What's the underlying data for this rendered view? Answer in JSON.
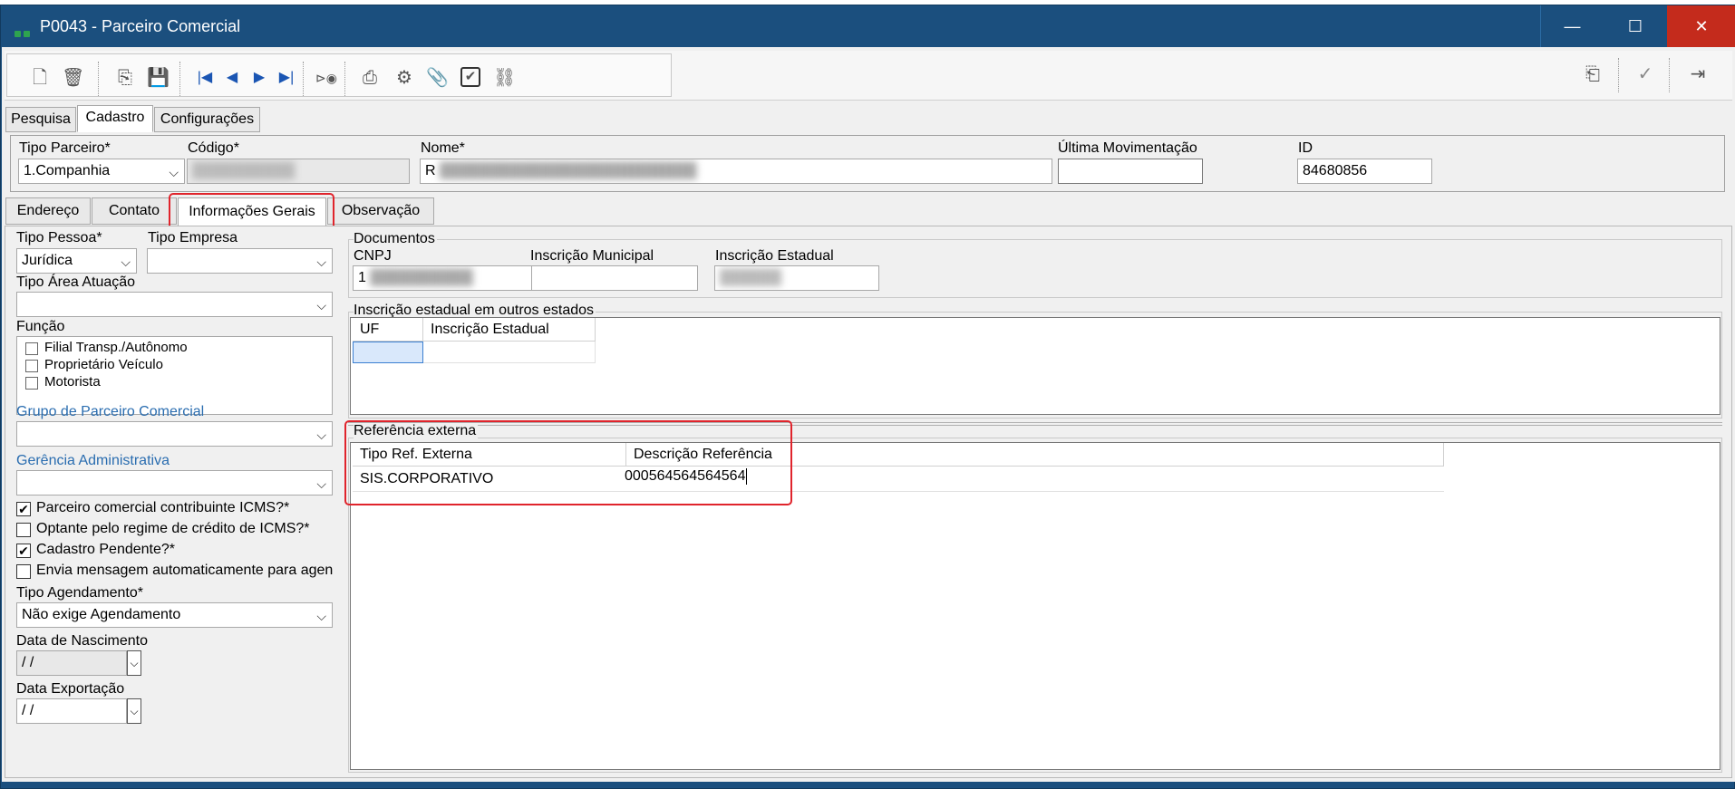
{
  "window": {
    "title": "P0043 - Parceiro Comercial",
    "controls": {
      "minimize": "—",
      "maximize": "☐",
      "close": "✕"
    }
  },
  "toolbar": {
    "left_icons": [
      "new-document-icon",
      "delete-icon",
      "copy-icon",
      "save-icon",
      "first-record-icon",
      "prev-record-icon",
      "next-record-icon",
      "last-record-icon",
      "search-record-icon",
      "print-icon",
      "settings-icon",
      "attach-icon",
      "checkbox-icon",
      "link-icon"
    ],
    "right_icons": [
      "import-icon",
      "confirm-check-icon",
      "exit-icon"
    ]
  },
  "main_tabs": [
    "Pesquisa",
    "Cadastro",
    "Configurações"
  ],
  "header": {
    "tipo_parceiro_label": "Tipo Parceiro*",
    "tipo_parceiro_value": "1.Companhia",
    "codigo_label": "Código*",
    "codigo_value": "",
    "nome_label": "Nome*",
    "nome_value": "R",
    "ultima_mov_label": "Última Movimentação",
    "ultima_mov_value": "",
    "id_label": "ID",
    "id_value": "84680856"
  },
  "sub_tabs": [
    "Endereço",
    "Contato",
    "Informações Gerais",
    "Observação"
  ],
  "left": {
    "tipo_pessoa_label": "Tipo Pessoa*",
    "tipo_pessoa_value": "Jurídica",
    "tipo_empresa_label": "Tipo Empresa",
    "tipo_empresa_value": "",
    "tipo_area_label": "Tipo Área Atuação",
    "tipo_area_value": "",
    "funcao_label": "Função",
    "funcao_items": [
      "Filial Transp./Autônomo",
      "Proprietário Veículo",
      "Motorista"
    ],
    "grupo_label": "Grupo de Parceiro Comercial",
    "grupo_value": "",
    "gerencia_label": "Gerência Administrativa",
    "gerencia_value": "",
    "checkboxes": [
      {
        "label": "Parceiro comercial contribuinte ICMS?*",
        "checked": "✔"
      },
      {
        "label": "Optante pelo regime de crédito de ICMS?*",
        "checked": ""
      },
      {
        "label": "Cadastro Pendente?*",
        "checked": "✔"
      },
      {
        "label": "Envia mensagem automaticamente para agen",
        "checked": ""
      }
    ],
    "tipo_agendamento_label": "Tipo Agendamento*",
    "tipo_agendamento_value": "Não exige Agendamento",
    "data_nascimento_label": "Data de Nascimento",
    "data_nascimento_value": " / /",
    "data_exportacao_label": "Data Exportação",
    "data_exportacao_value": " / /"
  },
  "documentos": {
    "title": "Documentos",
    "cnpj_label": "CNPJ",
    "cnpj_value": "1",
    "insc_municipal_label": "Inscrição Municipal",
    "insc_municipal_value": "",
    "insc_estadual_label": "Inscrição Estadual",
    "insc_estadual_value": ""
  },
  "outros_estados": {
    "title": "Inscrição estadual em outros estados",
    "columns": [
      "UF",
      "Inscrição Estadual"
    ]
  },
  "referencia": {
    "title": "Referência externa",
    "columns": [
      "Tipo Ref. Externa",
      "Descrição Referência"
    ],
    "rows": [
      {
        "tipo": "SIS.CORPORATIVO",
        "descricao": "000564564564564"
      }
    ]
  },
  "colors": {
    "titlebar": "#1b4f7e",
    "highlight": "#e0242c",
    "link": "#2a6db0",
    "close": "#c42b1c"
  }
}
